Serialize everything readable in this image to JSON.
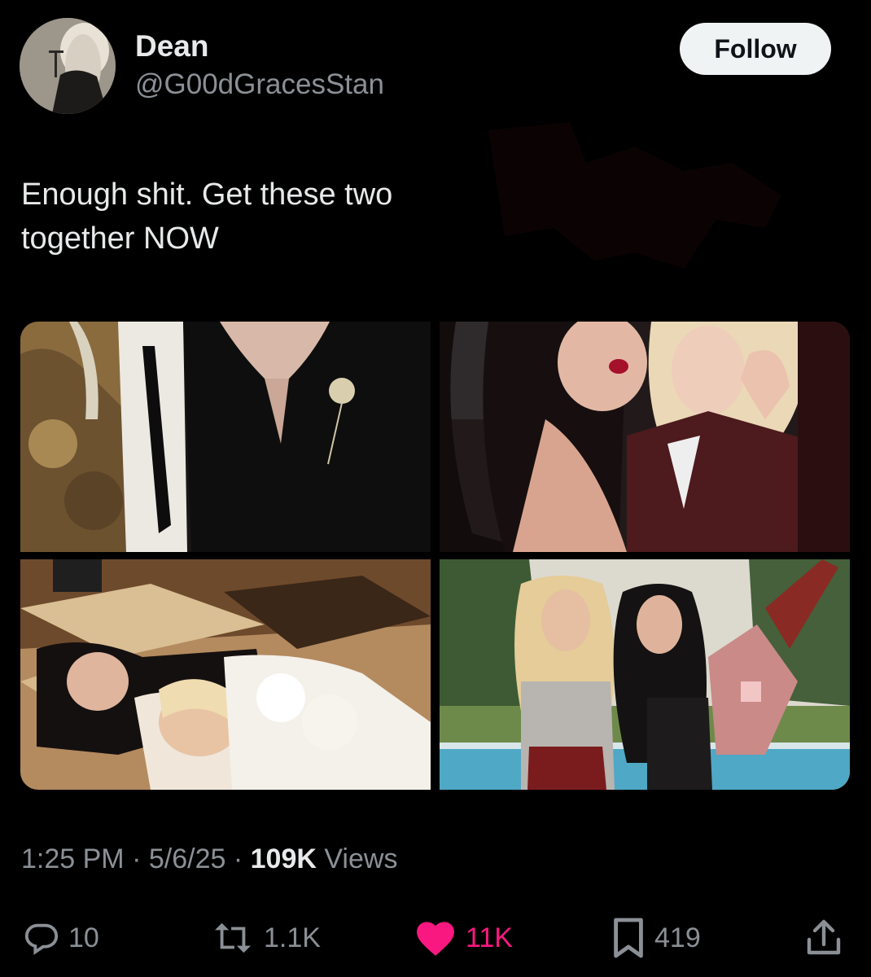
{
  "author": {
    "display_name": "Dean",
    "handle": "@G00dGracesStan",
    "avatar_icon": "profile-photo"
  },
  "follow_button": {
    "label": "Follow"
  },
  "tweet": {
    "text_line1": "Enough shit. Get these two",
    "text_line2": "together NOW"
  },
  "media": {
    "photos": [
      {
        "name": "photo-1",
        "description_icon": "photo"
      },
      {
        "name": "photo-2",
        "description_icon": "photo"
      },
      {
        "name": "photo-3",
        "description_icon": "photo"
      },
      {
        "name": "photo-4",
        "description_icon": "photo"
      }
    ]
  },
  "meta": {
    "time": "1:25 PM",
    "separator": "·",
    "date": "5/6/25",
    "views_count": "109K",
    "views_label": "Views"
  },
  "actions": {
    "replies": "10",
    "reposts": "1.1K",
    "likes": "11K",
    "bookmarks": "419"
  },
  "colors": {
    "background": "#000000",
    "text_primary": "#e7e9ea",
    "text_secondary": "#8b9096",
    "like_active": "#f91880",
    "follow_bg": "#eff3f4"
  }
}
